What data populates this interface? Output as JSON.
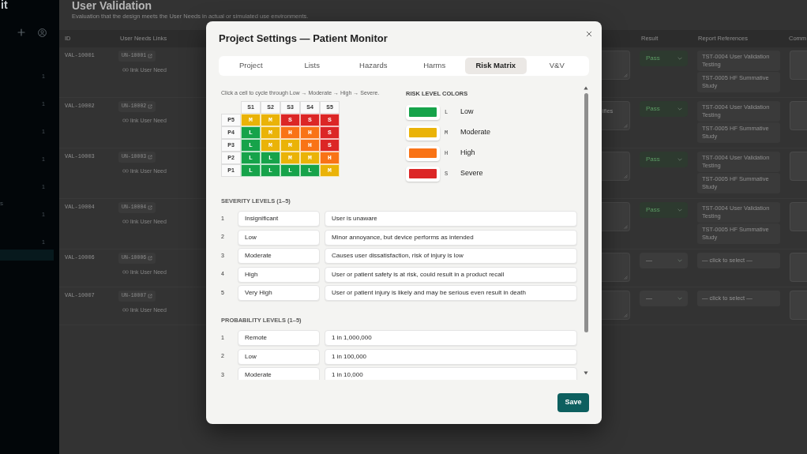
{
  "sidebar": {
    "brand": "it",
    "items": [
      {
        "count": "1",
        "selected": false
      },
      {
        "count": "1",
        "selected": false
      },
      {
        "count": "1",
        "selected": false
      },
      {
        "count": "1",
        "selected": false
      },
      {
        "count": "1",
        "selected": false
      },
      {
        "label": "s",
        "count": "1",
        "selected": false
      },
      {
        "count": "1",
        "selected": false
      },
      {
        "selected": true
      }
    ]
  },
  "page": {
    "title": "User Validation",
    "subtitle": "Evaluation that the design meets the User Needs in actual or simulated use environments."
  },
  "table": {
    "columns": [
      "ID",
      "User Needs Links",
      "Result",
      "Report References",
      "Comm"
    ],
    "rows": [
      {
        "id": "VAL-10001",
        "user_need": "UN-10001",
        "link_action": "link User Need",
        "result": {
          "text": "Pass",
          "kind": "pass"
        },
        "references": [
          "TST-0004 User Validation Testing",
          "TST-0005 HF Summative Study"
        ]
      },
      {
        "id": "VAL-10002",
        "user_need": "UN-10002",
        "link_action": "link User Need",
        "column_3": "ifies",
        "result": {
          "text": "Pass",
          "kind": "pass"
        },
        "references": [
          "TST-0004 User Validation Testing",
          "TST-0005 HF Summative Study"
        ]
      },
      {
        "id": "VAL-10003",
        "user_need": "UN-10003",
        "link_action": "link User Need",
        "result": {
          "text": "Pass",
          "kind": "pass"
        },
        "references": [
          "TST-0004 User Validation Testing",
          "TST-0005 HF Summative Study"
        ]
      },
      {
        "id": "VAL-10004",
        "user_need": "UN-10004",
        "link_action": "link User Need",
        "result": {
          "text": "Pass",
          "kind": "pass"
        },
        "references": [
          "TST-0004 User Validation Testing",
          "TST-0005 HF Summative Study"
        ]
      },
      {
        "id": "VAL-10006",
        "user_need": "UN-10006",
        "link_action": "link User Need",
        "result": {
          "text": "—",
          "kind": "empty"
        },
        "references_placeholder": "— click to select —"
      },
      {
        "id": "VAL-10007",
        "user_need": "UN-10007",
        "link_action": "link User Need",
        "result": {
          "text": "—",
          "kind": "empty"
        },
        "references_placeholder": "— click to select —"
      }
    ]
  },
  "modal": {
    "title": "Project Settings — Patient Monitor",
    "tabs": [
      {
        "label": "Project",
        "selected": false
      },
      {
        "label": "Lists",
        "selected": false
      },
      {
        "label": "Hazards",
        "selected": false
      },
      {
        "label": "Harms",
        "selected": false
      },
      {
        "label": "Risk Matrix",
        "selected": true
      },
      {
        "label": "V&V",
        "selected": false
      }
    ],
    "risk_matrix": {
      "hint": "Click a cell to cycle through Low → Moderate → High → Severe.",
      "columns": [
        "S1",
        "S2",
        "S3",
        "S4",
        "S5"
      ],
      "rows": [
        {
          "label": "P5",
          "cells": [
            {
              "text": "M",
              "color": "#eab308"
            },
            {
              "text": "M",
              "color": "#eab308"
            },
            {
              "text": "S",
              "color": "#dc2626"
            },
            {
              "text": "S",
              "color": "#dc2626"
            },
            {
              "text": "S",
              "color": "#dc2626"
            }
          ]
        },
        {
          "label": "P4",
          "cells": [
            {
              "text": "L",
              "color": "#16a34a"
            },
            {
              "text": "M",
              "color": "#eab308"
            },
            {
              "text": "H",
              "color": "#f97316"
            },
            {
              "text": "H",
              "color": "#f97316"
            },
            {
              "text": "S",
              "color": "#dc2626"
            }
          ]
        },
        {
          "label": "P3",
          "cells": [
            {
              "text": "L",
              "color": "#16a34a"
            },
            {
              "text": "M",
              "color": "#eab308"
            },
            {
              "text": "M",
              "color": "#eab308"
            },
            {
              "text": "H",
              "color": "#f97316"
            },
            {
              "text": "S",
              "color": "#dc2626"
            }
          ]
        },
        {
          "label": "P2",
          "cells": [
            {
              "text": "L",
              "color": "#16a34a"
            },
            {
              "text": "L",
              "color": "#16a34a"
            },
            {
              "text": "M",
              "color": "#eab308"
            },
            {
              "text": "M",
              "color": "#eab308"
            },
            {
              "text": "H",
              "color": "#f97316"
            }
          ]
        },
        {
          "label": "P1",
          "cells": [
            {
              "text": "L",
              "color": "#16a34a"
            },
            {
              "text": "L",
              "color": "#16a34a"
            },
            {
              "text": "L",
              "color": "#16a34a"
            },
            {
              "text": "L",
              "color": "#16a34a"
            },
            {
              "text": "M",
              "color": "#eab308"
            }
          ]
        }
      ]
    },
    "legend": {
      "title": "RISK LEVEL COLORS",
      "items": [
        {
          "code": "L",
          "label": "Low",
          "color": "#16a34a"
        },
        {
          "code": "M",
          "label": "Moderate",
          "color": "#eab308"
        },
        {
          "code": "H",
          "label": "High",
          "color": "#f97316"
        },
        {
          "code": "S",
          "label": "Severe",
          "color": "#dc2626"
        }
      ]
    },
    "severity_levels": {
      "title": "SEVERITY LEVELS (1–5)",
      "rows": [
        {
          "number": "1",
          "name": "Insignificant",
          "description": "User is unaware"
        },
        {
          "number": "2",
          "name": "Low",
          "description": "Minor annoyance, but device performs as intended"
        },
        {
          "number": "3",
          "name": "Moderate",
          "description": "Causes user dissatisfaction, risk of injury is low"
        },
        {
          "number": "4",
          "name": "High",
          "description": "User or patient safety is at risk, could result in a product recall"
        },
        {
          "number": "5",
          "name": "Very High",
          "description": "User or patient injury is likely and may be serious even result in death"
        }
      ]
    },
    "probability_levels": {
      "title": "PROBABILITY LEVELS (1–5)",
      "rows": [
        {
          "number": "1",
          "name": "Remote",
          "description": "1 in 1,000,000"
        },
        {
          "number": "2",
          "name": "Low",
          "description": "1 in 100,000"
        },
        {
          "number": "3",
          "name": "Moderate",
          "description": "1 in 10,000"
        }
      ]
    },
    "save_button": "Save"
  }
}
